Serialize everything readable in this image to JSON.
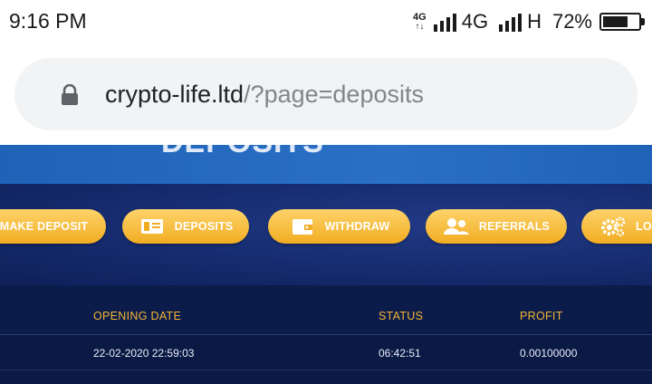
{
  "status_bar": {
    "time": "9:16 PM",
    "net_small": "4G",
    "net_arrows": "↑↓",
    "network1": "4G",
    "network2": "H",
    "battery": "72%",
    "battery_level": 0.72
  },
  "browser": {
    "url_host": "crypto-life.ltd",
    "url_path": "/?page=deposits"
  },
  "page": {
    "title": "DEPOSITS",
    "nav": [
      {
        "label": "MAKE DEPOSIT",
        "icon": "none"
      },
      {
        "label": "DEPOSITS",
        "icon": "money-bill-icon"
      },
      {
        "label": "WITHDRAW",
        "icon": "wallet-icon"
      },
      {
        "label": "REFERRALS",
        "icon": "users-icon"
      },
      {
        "label": "LO",
        "icon": "gears-icon"
      }
    ],
    "table": {
      "headers": [
        "OPENING DATE",
        "STATUS",
        "PROFIT"
      ],
      "rows": [
        [
          "22-02-2020 22:59:03",
          "06:42:51",
          "0.00100000"
        ]
      ]
    }
  },
  "colors": {
    "accent": "#f5b731",
    "banner": "#2466b8",
    "dark_bg": "#0d1b4f"
  }
}
